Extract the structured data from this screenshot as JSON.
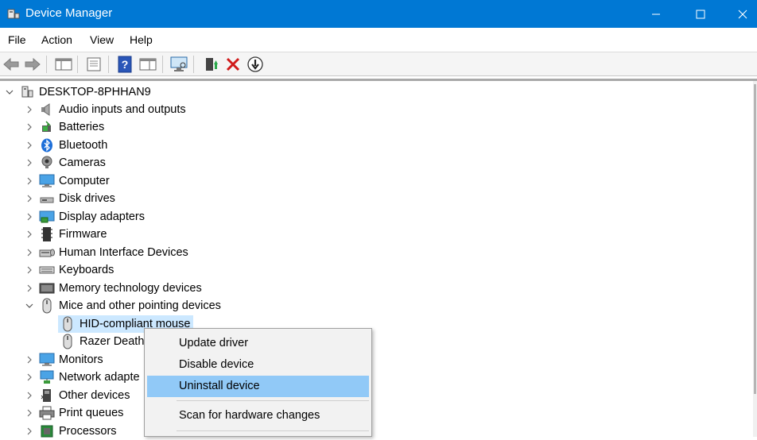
{
  "window": {
    "title": "Device Manager"
  },
  "menu": [
    "File",
    "Action",
    "View",
    "Help"
  ],
  "toolbar": [
    "back-icon",
    "forward-icon",
    "show-hide-console-tree-icon",
    "properties-icon",
    "help-icon",
    "action-pane-icon",
    "scan-hardware-icon",
    "update-driver-icon",
    "uninstall-icon",
    "disable-icon"
  ],
  "tree": {
    "root": "DESKTOP-8PHHAN9",
    "categories": [
      {
        "label": "Audio inputs and outputs",
        "icon": "speaker-icon"
      },
      {
        "label": "Batteries",
        "icon": "battery-icon"
      },
      {
        "label": "Bluetooth",
        "icon": "bluetooth-icon"
      },
      {
        "label": "Cameras",
        "icon": "camera-icon"
      },
      {
        "label": "Computer",
        "icon": "computer-icon"
      },
      {
        "label": "Disk drives",
        "icon": "disk-drive-icon"
      },
      {
        "label": "Display adapters",
        "icon": "display-adapter-icon"
      },
      {
        "label": "Firmware",
        "icon": "firmware-icon"
      },
      {
        "label": "Human Interface Devices",
        "icon": "hid-icon"
      },
      {
        "label": "Keyboards",
        "icon": "keyboard-icon"
      },
      {
        "label": "Memory technology devices",
        "icon": "memory-icon"
      },
      {
        "label": "Mice and other pointing devices",
        "icon": "mouse-icon",
        "expanded": true,
        "children": [
          {
            "label": "HID-compliant mouse",
            "selected": true
          },
          {
            "label": "Razer DeathA"
          }
        ]
      },
      {
        "label": "Monitors",
        "icon": "monitor-icon"
      },
      {
        "label": "Network adapte",
        "icon": "network-icon"
      },
      {
        "label": "Other devices",
        "icon": "other-devices-icon"
      },
      {
        "label": "Print queues",
        "icon": "printer-icon"
      },
      {
        "label": "Processors",
        "icon": "processor-icon"
      }
    ]
  },
  "context_menu": {
    "items": [
      "Update driver",
      "Disable device",
      "Uninstall device",
      "Scan for hardware changes"
    ],
    "highlighted": "Uninstall device"
  },
  "colors": {
    "titlebar": "#0078d4",
    "selection": "#cce8ff",
    "menu_highlight": "#91c9f7"
  }
}
